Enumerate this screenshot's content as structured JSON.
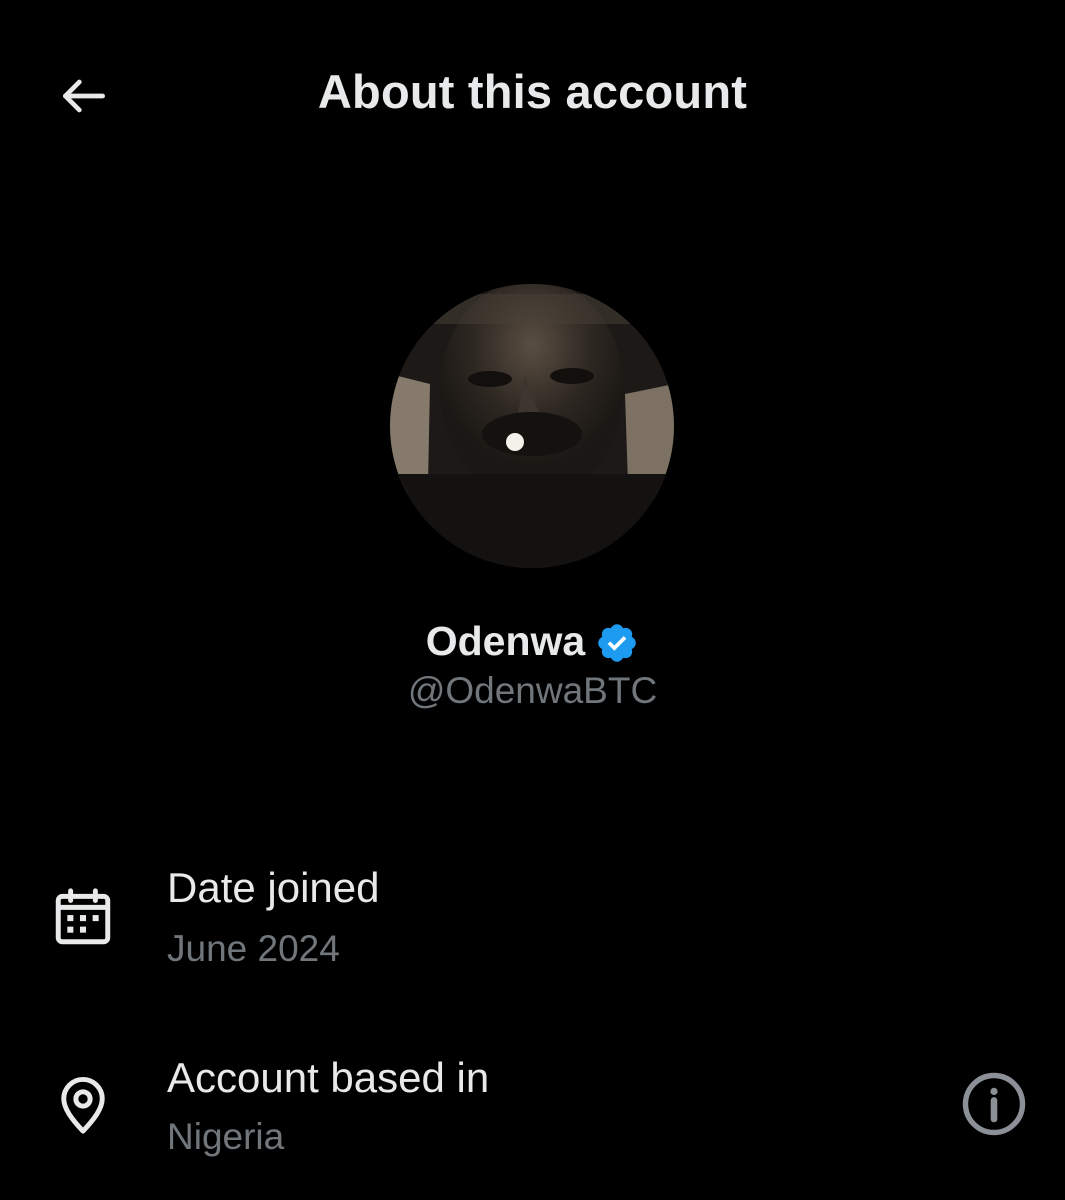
{
  "header": {
    "title": "About this account",
    "back_icon": "arrow-left-icon"
  },
  "profile": {
    "display_name": "Odenwa",
    "handle": "@OdenwaBTC",
    "verified": true,
    "verified_color": "#1d9bf0"
  },
  "details": [
    {
      "icon": "calendar-icon",
      "label": "Date joined",
      "value": "June 2024"
    },
    {
      "icon": "location-pin-icon",
      "label": "Account based in",
      "value": "Nigeria",
      "action_icon": "info-icon"
    }
  ],
  "colors": {
    "background": "#000000",
    "primary_text": "#e7e9ea",
    "secondary_text": "#71767b",
    "accent": "#1d9bf0"
  }
}
